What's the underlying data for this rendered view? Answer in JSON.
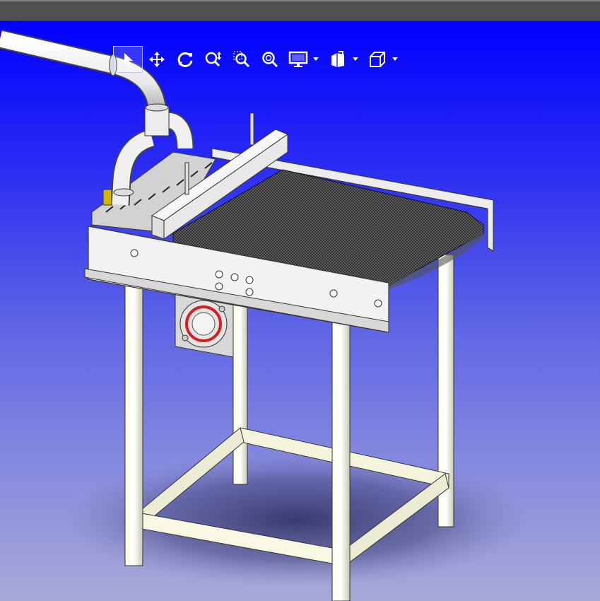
{
  "window": {
    "titlebar_color": "#505050"
  },
  "viewport": {
    "background_top": "#0000ff",
    "background_bottom": "#a7aad6",
    "model": "conveyor-table-assembly"
  },
  "toolbar": {
    "items": [
      {
        "id": "select",
        "icon": "select-arrow-icon",
        "active": true
      },
      {
        "id": "pan",
        "icon": "pan-icon",
        "active": false
      },
      {
        "id": "rotate",
        "icon": "rotate-icon",
        "active": false
      },
      {
        "id": "zoom",
        "icon": "zoom-icon",
        "active": false
      },
      {
        "id": "zoom-area",
        "icon": "zoom-area-icon",
        "active": false
      },
      {
        "id": "zoom-fit",
        "icon": "zoom-fit-icon",
        "active": false
      },
      {
        "id": "display-mode",
        "icon": "monitor-icon",
        "dropdown": true
      },
      {
        "id": "section-view",
        "icon": "section-view-icon",
        "dropdown": true
      },
      {
        "id": "view-orientation",
        "icon": "cube-icon",
        "dropdown": true
      }
    ],
    "icon_color": "#ffffff"
  }
}
